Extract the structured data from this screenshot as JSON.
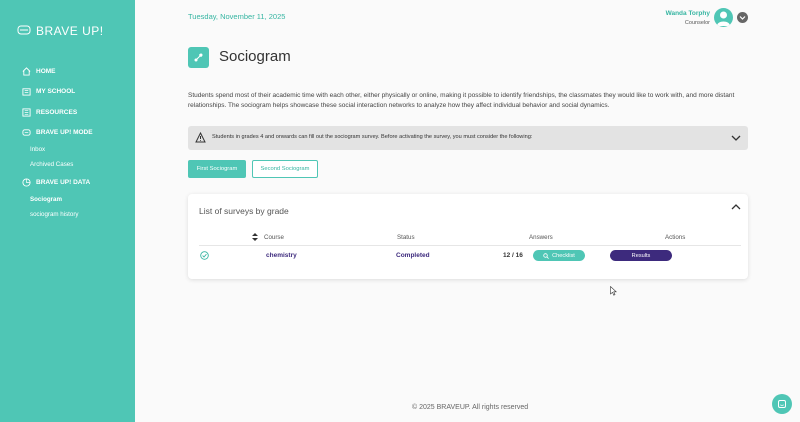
{
  "brand": {
    "logo_text": "BRAVE UP!"
  },
  "sidebar": {
    "items": [
      {
        "label": "HOME",
        "icon": "home-icon"
      },
      {
        "label": "MY SCHOOL",
        "icon": "school-icon"
      },
      {
        "label": "RESOURCES",
        "icon": "resources-icon"
      },
      {
        "label": "BRAVE UP! MODE",
        "icon": "mode-icon"
      },
      {
        "label": "BRAVE UP! DATA",
        "icon": "data-icon"
      }
    ],
    "mode_sub": [
      "Inbox",
      "Archived Cases"
    ],
    "data_sub": [
      "Sociogram",
      "sociogram history"
    ]
  },
  "header": {
    "date": "Tuesday, November 11, 2025",
    "user_name": "Wanda Torphy",
    "user_role": "Counselor"
  },
  "page": {
    "title": "Sociogram",
    "description": "Students spend most of their academic time with each other, either physically or online, making it possible to identify friendships, the classmates they would like to work with, and more distant relationships. The sociogram helps showcase these social interaction networks to analyze how they affect individual behavior and social dynamics.",
    "notice": "Students in grades 4 and onwards can fill out the sociogram survey. Before activating the survey, you must consider the following:",
    "first_button": "First Sociogram",
    "second_button": "Second Sociogram"
  },
  "surveys": {
    "title": "List of surveys by grade",
    "columns": {
      "course": "Course",
      "status": "Status",
      "answers": "Answers",
      "actions": "Actions"
    },
    "row": {
      "course": "chemistry",
      "status": "Completed",
      "answers": "12 / 16",
      "checklist_label": "Checklist",
      "results_label": "Results"
    }
  },
  "footer": {
    "text": "© 2025 BRAVEUP. All rights reserved"
  },
  "colors": {
    "accent": "#4fc6b5",
    "accent_dark": "#36b5a2",
    "purple": "#3d2a7d",
    "sidebar": "#4fc6b5"
  }
}
